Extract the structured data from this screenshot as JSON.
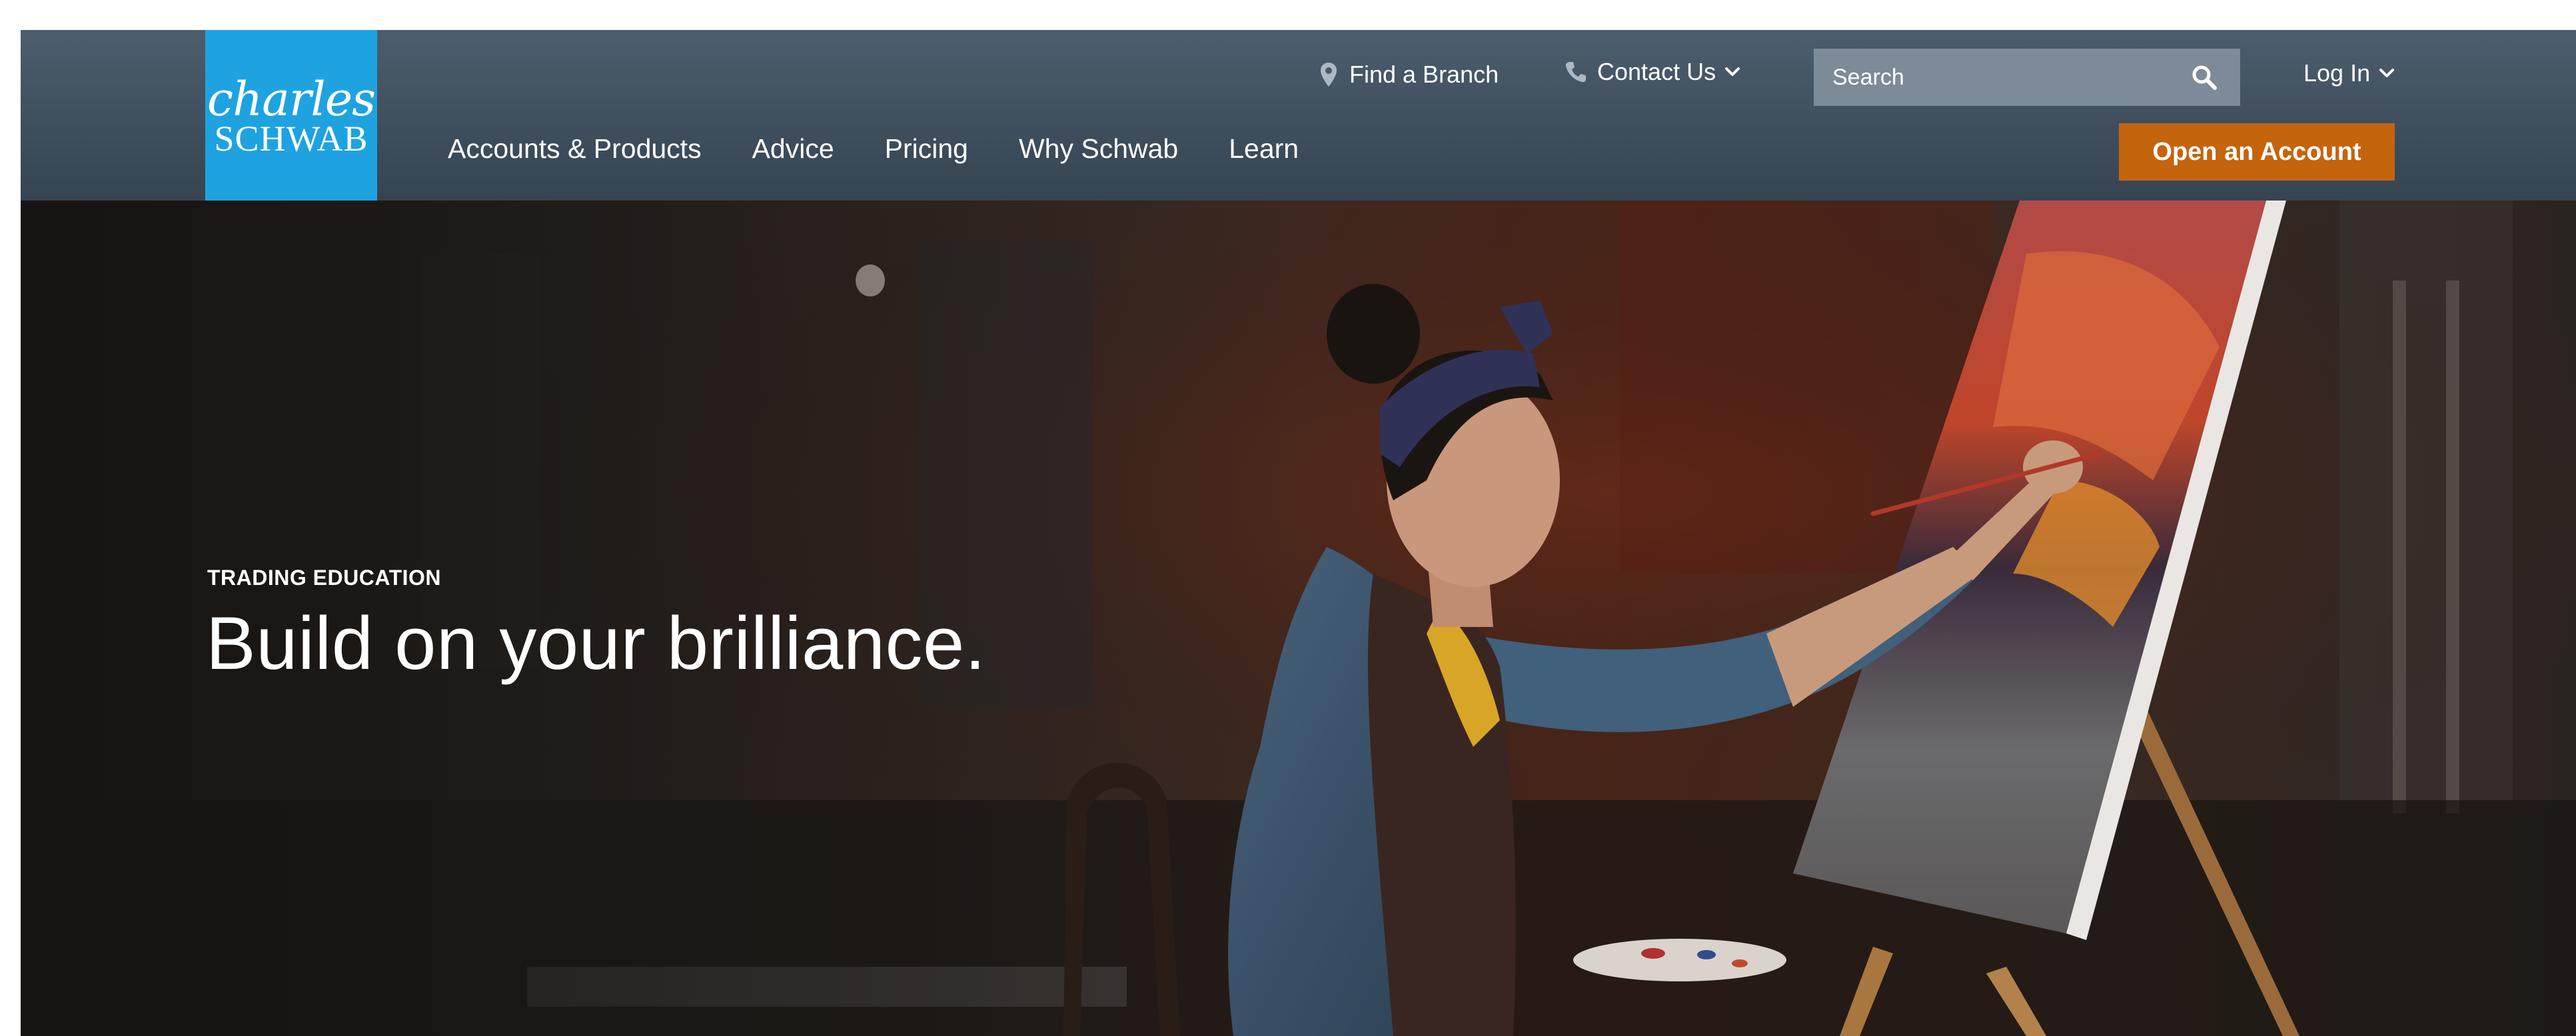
{
  "logo": {
    "line1": "charles",
    "line2": "SCHWAB",
    "color": "#1ea3e0"
  },
  "utility": {
    "find_branch": {
      "label": "Find a Branch",
      "icon": "map-pin-icon"
    },
    "contact_us": {
      "label": "Contact Us",
      "icon": "phone-icon",
      "caret": "chevron-down-icon"
    },
    "search": {
      "placeholder": "Search",
      "value": "",
      "icon": "search-icon"
    },
    "login": {
      "label": "Log In",
      "caret": "chevron-down-icon"
    }
  },
  "nav": {
    "items": [
      {
        "label": "Accounts & Products"
      },
      {
        "label": "Advice"
      },
      {
        "label": "Pricing"
      },
      {
        "label": "Why Schwab"
      },
      {
        "label": "Learn"
      }
    ]
  },
  "cta": {
    "open_account": "Open an Account",
    "color": "#c4640c"
  },
  "hero": {
    "eyebrow": "TRADING EDUCATION",
    "title": "Build on your brilliance."
  },
  "colors": {
    "header_bg": "#415161",
    "search_bg": "#7d8b98"
  }
}
